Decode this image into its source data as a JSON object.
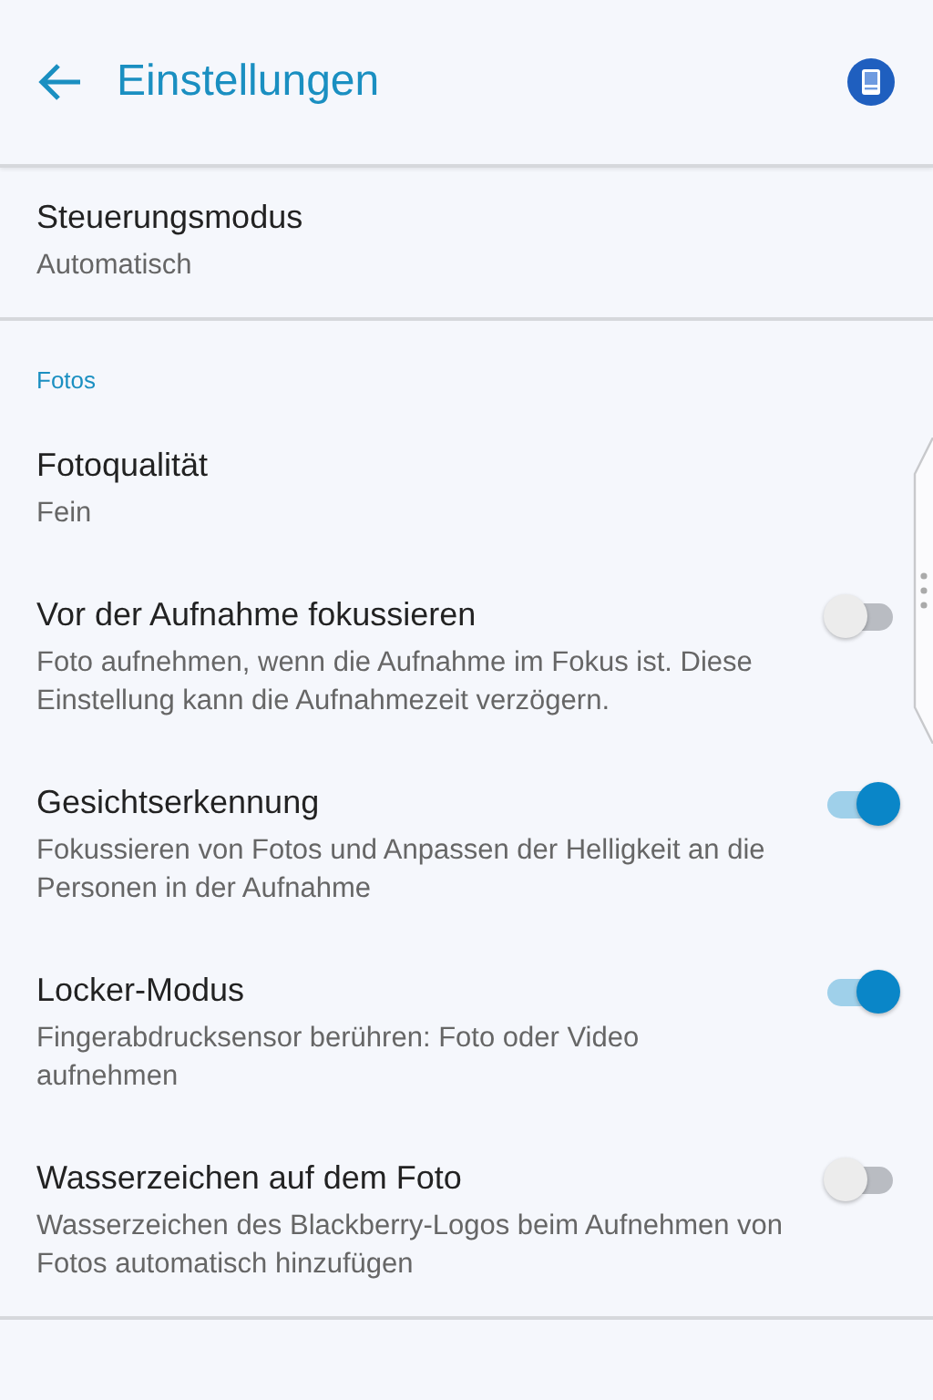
{
  "app_bar": {
    "title": "Einstellungen"
  },
  "groups": [
    {
      "items": [
        {
          "kind": "value",
          "title": "Steuerungsmodus",
          "subtitle": "Automatisch"
        }
      ]
    },
    {
      "header": "Fotos",
      "items": [
        {
          "kind": "value",
          "title": "Fotoqualität",
          "subtitle": "Fein"
        },
        {
          "kind": "toggle",
          "title": "Vor der Aufnahme fokussieren",
          "subtitle": "Foto aufnehmen, wenn die Aufnahme im Fokus ist. Diese Einstellung kann die Aufnahmezeit verzögern.",
          "on": false
        },
        {
          "kind": "toggle",
          "title": "Gesichtserkennung",
          "subtitle": "Fokussieren von Fotos und Anpassen der Helligkeit an die Personen in der Aufnahme",
          "on": true
        },
        {
          "kind": "toggle",
          "title": "Locker-Modus",
          "subtitle": "Fingerabdrucksensor berühren: Foto oder Video aufnehmen",
          "on": true
        },
        {
          "kind": "toggle",
          "title": "Wasserzeichen auf dem Foto",
          "subtitle": "Wasserzeichen des Blackberry-Logos beim Aufnehmen von Fotos automatisch hinzufügen",
          "on": false
        }
      ]
    }
  ]
}
